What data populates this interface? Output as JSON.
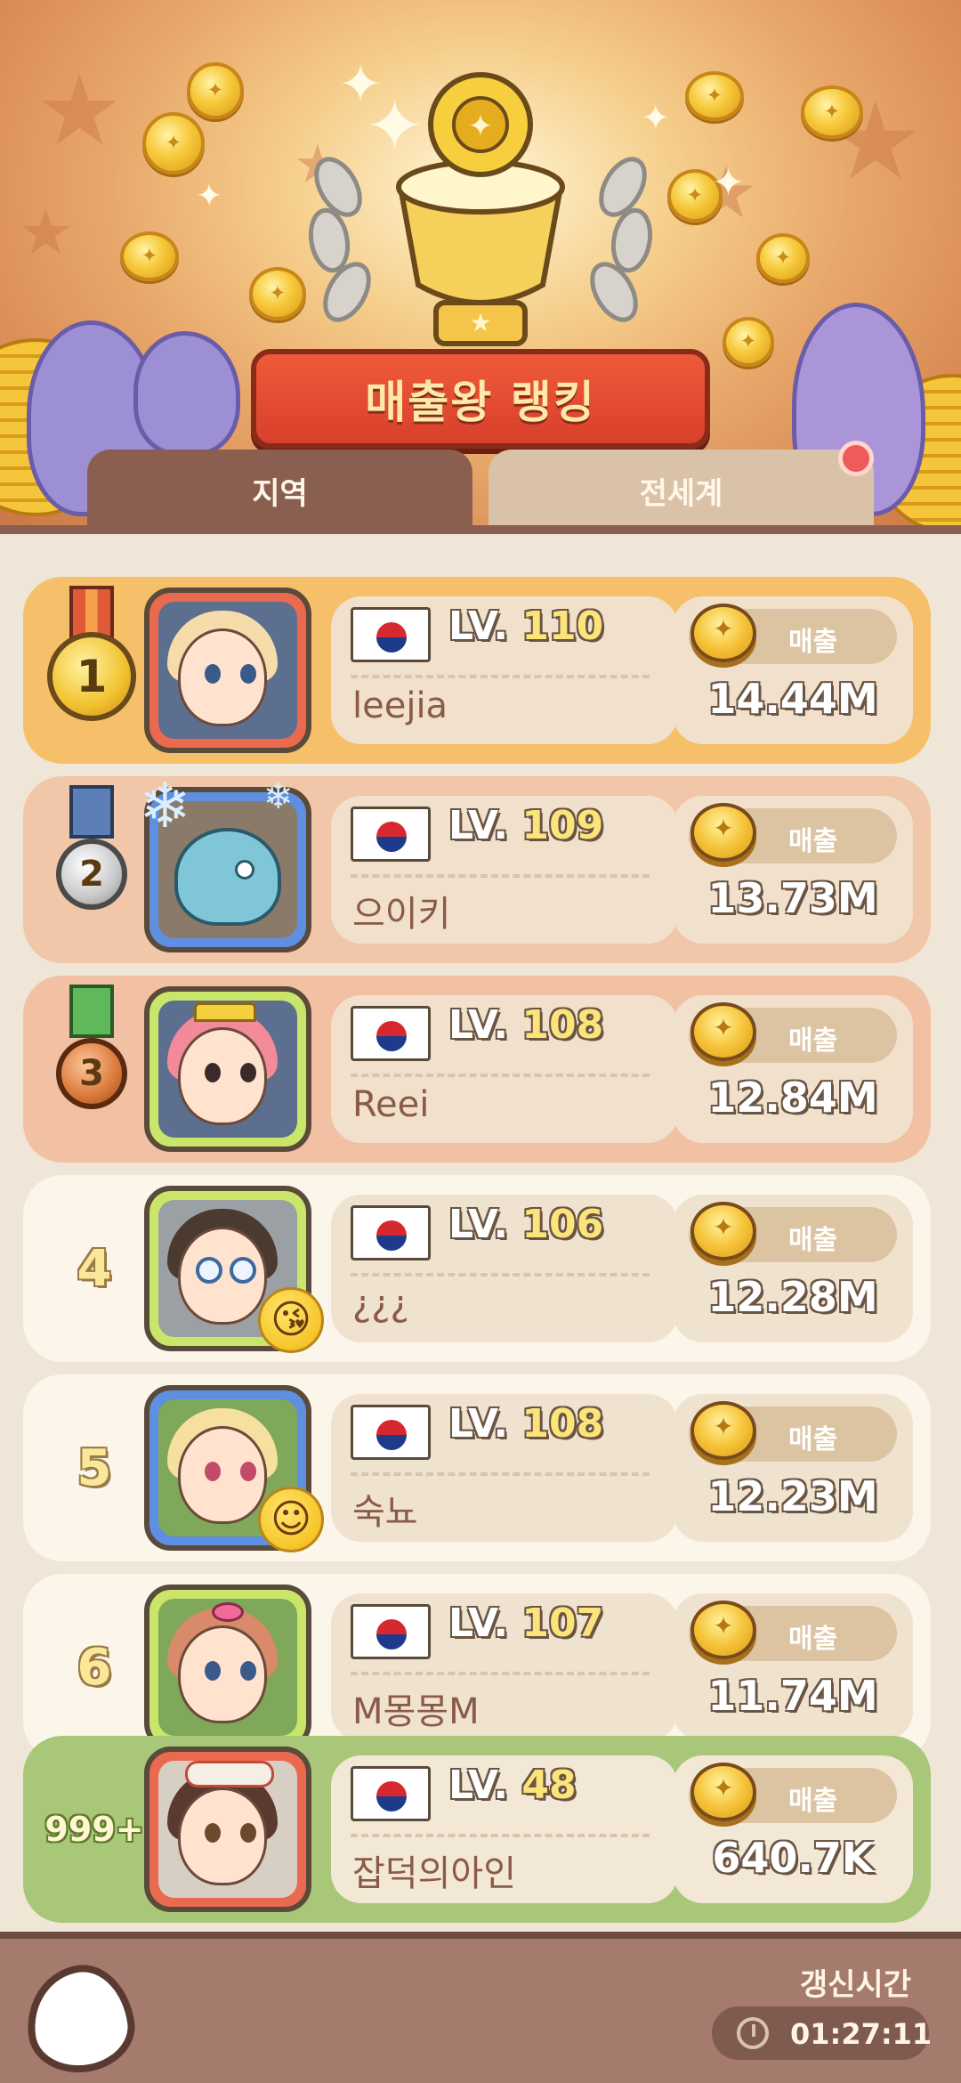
{
  "header": {
    "title": "매출왕 랭킹",
    "tabs": [
      {
        "label": "지역",
        "active": true
      },
      {
        "label": "전세계",
        "active": false
      }
    ]
  },
  "colors": {
    "gold_row": "#f5c069",
    "silver_row": "#f2c6a9",
    "bronze_row": "#f2c0a2",
    "plain_row": "#fbf5ea",
    "my_row": "#a8c778",
    "tab_active": "#8b5f4f",
    "tab_inactive": "#d9c2a7"
  },
  "ranking": [
    {
      "rank": "1",
      "level_prefix": "LV.",
      "level": "110",
      "name": "leejia",
      "sales_label": "매출",
      "sales": "14.44M",
      "frame": "red"
    },
    {
      "rank": "2",
      "level_prefix": "LV.",
      "level": "109",
      "name": "으이키",
      "sales_label": "매출",
      "sales": "13.73M",
      "frame": "blue"
    },
    {
      "rank": "3",
      "level_prefix": "LV.",
      "level": "108",
      "name": "Reei",
      "sales_label": "매출",
      "sales": "12.84M",
      "frame": "green"
    },
    {
      "rank": "4",
      "level_prefix": "LV.",
      "level": "106",
      "name": "¿¿¿",
      "sales_label": "매출",
      "sales": "12.28M",
      "frame": "green"
    },
    {
      "rank": "5",
      "level_prefix": "LV.",
      "level": "108",
      "name": "숙뇨",
      "sales_label": "매출",
      "sales": "12.23M",
      "frame": "blue"
    },
    {
      "rank": "6",
      "level_prefix": "LV.",
      "level": "107",
      "name": "M몽몽M",
      "sales_label": "매출",
      "sales": "11.74M",
      "frame": "green"
    }
  ],
  "my_rank": {
    "rank": "999+",
    "level_prefix": "LV.",
    "level": "48",
    "name": "잡덕의아인",
    "sales_label": "매출",
    "sales": "640.7K"
  },
  "footer": {
    "refresh_label": "갱신시간",
    "refresh_time": "01:27:11"
  }
}
